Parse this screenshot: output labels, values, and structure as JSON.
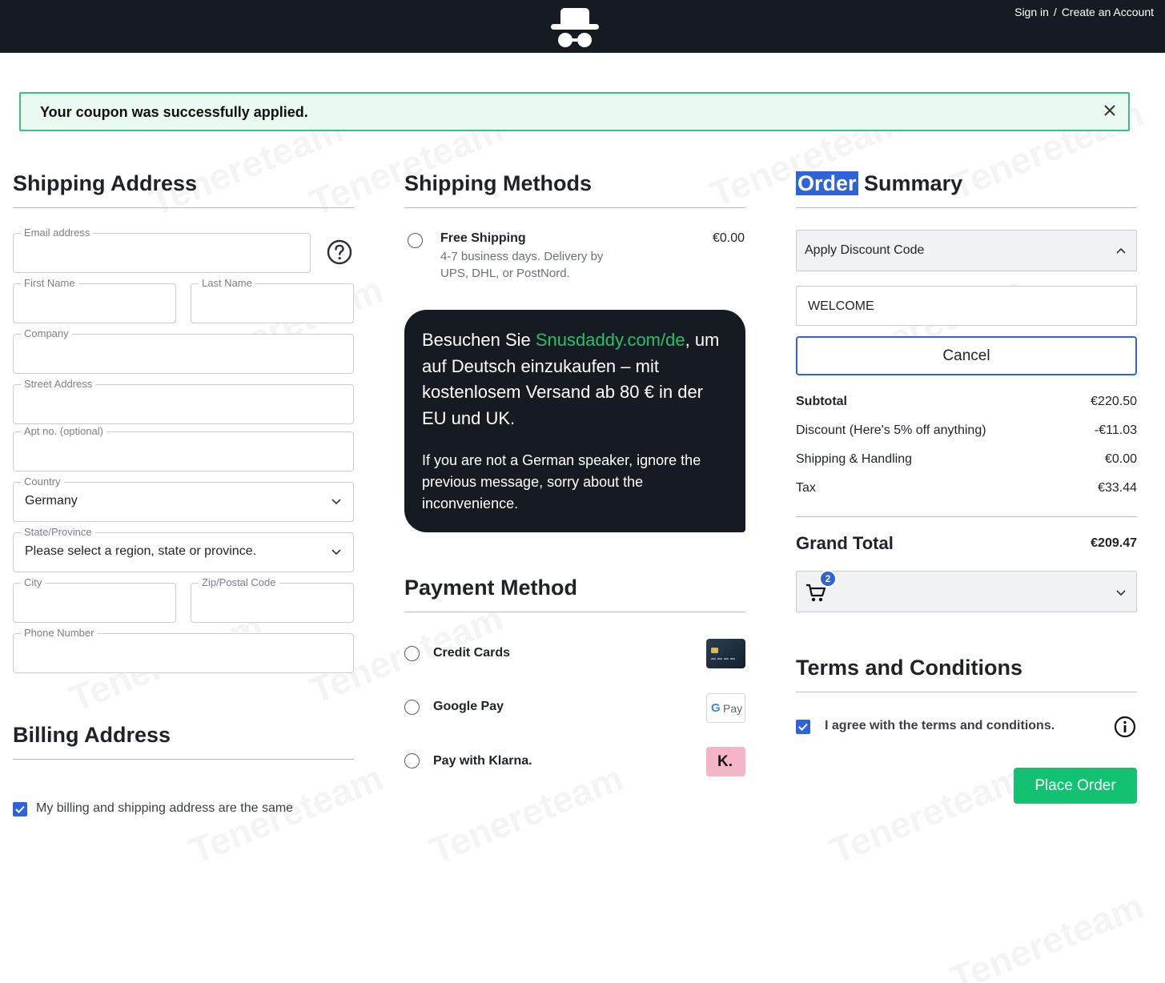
{
  "header": {
    "sign_in": "Sign in",
    "separator": "/",
    "create_account": "Create an Account",
    "logo_icon": "incognito-hat-glasses-icon"
  },
  "notice": {
    "message": "Your coupon was successfully applied."
  },
  "shipping_address": {
    "title": "Shipping Address",
    "email_label": "Email address",
    "first_name_label": "First Name",
    "last_name_label": "Last Name",
    "company_label": "Company",
    "street_label": "Street Address",
    "apt_label": "Apt no. (optional)",
    "country_label": "Country",
    "country_value": "Germany",
    "state_label": "State/Province",
    "state_value": "Please select a region, state or province.",
    "city_label": "City",
    "zip_label": "Zip/Postal Code",
    "phone_label": "Phone Number"
  },
  "billing_address": {
    "title": "Billing Address",
    "same_as_shipping": "My billing and shipping address are the same",
    "same_checked": true
  },
  "shipping_methods": {
    "title": "Shipping Methods",
    "option": {
      "name": "Free Shipping",
      "description": "4-7 business days. Delivery by UPS, DHL, or PostNord.",
      "price": "€0.00"
    }
  },
  "message_box": {
    "line1_prefix": "Besuchen Sie ",
    "line1_link": "Snusdaddy.com/de",
    "line1_suffix": ", um auf Deutsch einzukaufen – mit kostenlosem Versand ab 80 € in der EU und UK.",
    "line2": "If you are not a German speaker, ignore the previous message, sorry about the inconvenience.",
    "link_color": "#22c36b"
  },
  "payment_method": {
    "title": "Payment Method",
    "options": [
      {
        "label": "Credit Cards",
        "icon": "credit-card-icon"
      },
      {
        "label": "Google Pay",
        "icon": "google-pay-icon",
        "icon_text": "Pay"
      },
      {
        "label": "Pay with Klarna.",
        "icon": "klarna-icon",
        "icon_text": "K."
      }
    ]
  },
  "order_summary": {
    "title_highlight": "Order",
    "title_rest": " Summary",
    "discount_toggle": "Apply Discount Code",
    "discount_code": "WELCOME",
    "cancel_label": "Cancel",
    "rows": [
      {
        "label": "Subtotal",
        "value": "€220.50"
      },
      {
        "label": "Discount (Here's 5% off anything)",
        "value": "-€11.03"
      },
      {
        "label": "Shipping & Handling",
        "value": "€0.00"
      },
      {
        "label": "Tax",
        "value": "€33.44"
      }
    ],
    "grand_total_label": "Grand Total",
    "grand_total_value": "€209.47",
    "cart_count": "2"
  },
  "terms": {
    "title": "Terms and Conditions",
    "agree_text": "I agree with the terms and conditions.",
    "agree_checked": true,
    "place_order": "Place Order"
  },
  "colors": {
    "header_bg": "#161b22",
    "success_border": "#3dbf83",
    "success_bg": "#eafaf1",
    "accent_blue": "#2f64d6",
    "place_order_green": "#12c172"
  },
  "watermark": "Tenereteam"
}
